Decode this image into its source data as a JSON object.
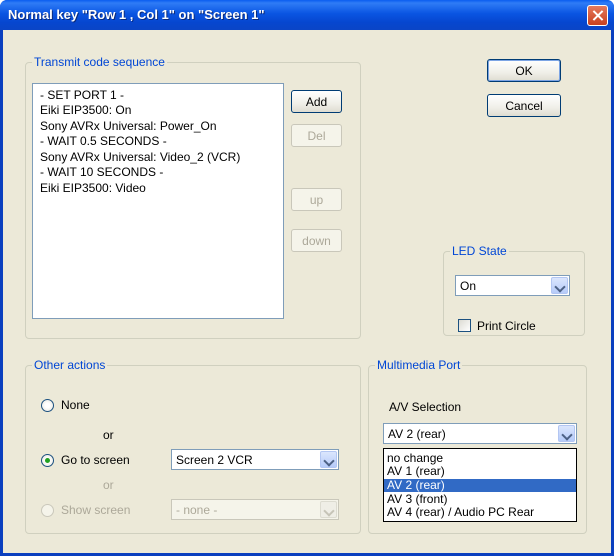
{
  "window": {
    "title": "Normal key \"Row 1 , Col 1\" on \"Screen 1\""
  },
  "transmit": {
    "group_label": "Transmit code sequence",
    "sequence": [
      "- SET PORT 1 -",
      "Eiki EIP3500: On",
      "Sony AVRx Universal: Power_On",
      "- WAIT 0.5 SECONDS -",
      "Sony AVRx Universal: Video_2 (VCR)",
      "- WAIT 10 SECONDS -",
      "Eiki EIP3500: Video"
    ],
    "add_label": "Add",
    "del_label": "Del",
    "up_label": "up",
    "down_label": "down"
  },
  "dialog_buttons": {
    "ok_label": "OK",
    "cancel_label": "Cancel"
  },
  "led": {
    "group_label": "LED State",
    "value": "On",
    "print_circle_label": "Print Circle",
    "print_circle_checked": false
  },
  "other_actions": {
    "group_label": "Other actions",
    "none_label": "None",
    "or_label_1": "or",
    "goto_label": "Go to screen",
    "goto_value": "Screen 2 VCR",
    "or_label_2": "or",
    "show_label": "Show screen",
    "show_value": "- none -",
    "selected": "goto"
  },
  "multimedia": {
    "group_label": "Multimedia Port",
    "av_label": "A/V Selection",
    "value": "AV 2 (rear)",
    "options": [
      "no change",
      "AV 1 (rear)",
      "AV 2 (rear)",
      "AV 3 (front)",
      "AV 4 (rear) / Audio PC Rear"
    ],
    "selected_index": 2
  },
  "colors": {
    "titlebar": "#0a55e2",
    "dialog_bg": "#ece9d8",
    "group_label": "#0046d5",
    "selection": "#316ac5"
  }
}
